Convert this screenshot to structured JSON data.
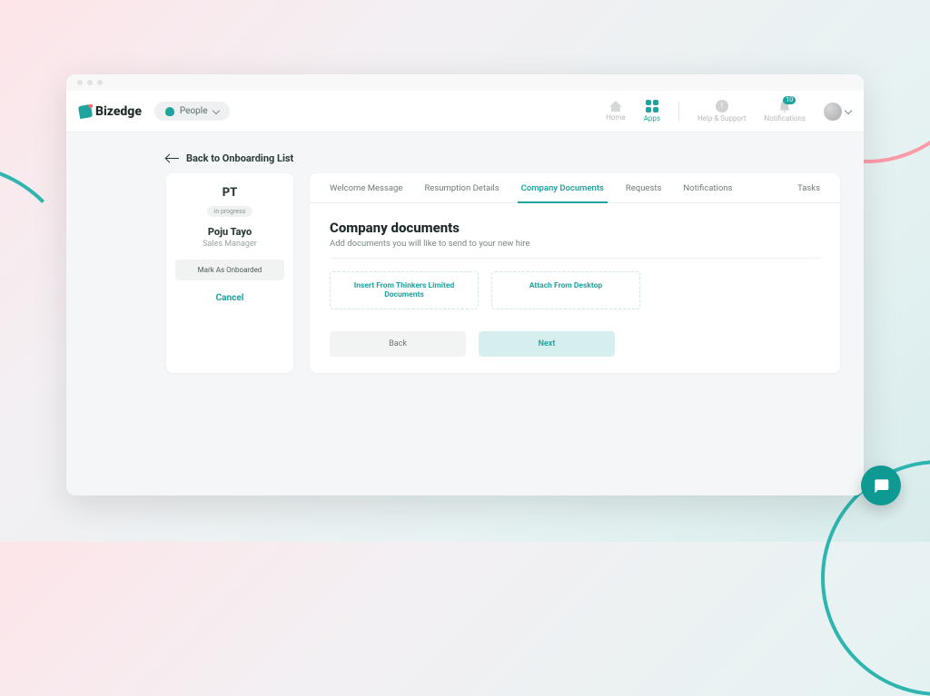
{
  "brand": {
    "name": "Bizedge"
  },
  "header": {
    "people_label": "People",
    "nav": {
      "home": "Home",
      "apps": "Apps",
      "help": "Help & Support",
      "notifications": "Notifications",
      "notification_count": "10"
    }
  },
  "back_link": "Back to Onboarding List",
  "profile": {
    "initials": "PT",
    "status": "in progress",
    "name": "Poju Tayo",
    "role": "Sales Manager",
    "mark_button": "Mark As Onboarded",
    "cancel": "Cancel"
  },
  "tabs": [
    {
      "label": "Welcome Message",
      "active": false
    },
    {
      "label": "Resumption Details",
      "active": false
    },
    {
      "label": "Company Documents",
      "active": true
    },
    {
      "label": "Requests",
      "active": false
    },
    {
      "label": "Notifications",
      "active": false
    },
    {
      "label": "Tasks",
      "active": false
    }
  ],
  "section": {
    "title": "Company documents",
    "subtitle": "Add documents you will like to send to your new hire",
    "insert_button": "Insert From Thinkers Limited Documents",
    "attach_button": "Attach From Desktop",
    "back_button": "Back",
    "next_button": "Next"
  },
  "colors": {
    "accent": "#1fa39e"
  }
}
